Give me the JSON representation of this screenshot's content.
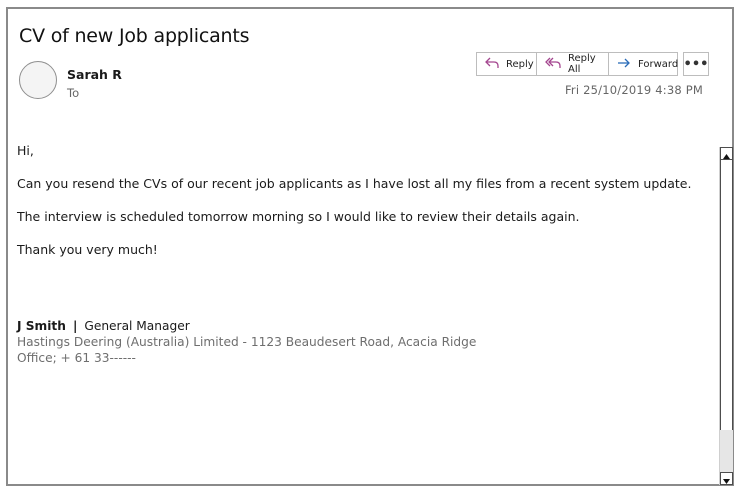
{
  "email": {
    "subject": "CV of new Job applicants",
    "sender": "Sarah R",
    "to_label": "To",
    "date": "Fri 25/10/2019 4:38 PM",
    "body": [
      "Hi,",
      "Can you resend the CVs of our recent job applicants as I have lost all my files from a recent system update.",
      "The interview is scheduled tomorrow morning so I would like to review their details again.",
      "Thank you very much!"
    ],
    "signature": {
      "name": "J Smith",
      "separator": "|",
      "title": "General Manager",
      "company_address": "Hastings Deering (Australia) Limited -  1123 Beaudesert Road, Acacia Ridge",
      "office": "Office; + 61 33------"
    }
  },
  "toolbar": {
    "reply_label": "Reply",
    "reply_all_label": "Reply All",
    "forward_label": "Forward",
    "more_label": "•••"
  },
  "icons": {
    "reply": "reply-arrow-icon",
    "reply_all": "reply-all-arrow-icon",
    "forward": "forward-arrow-icon",
    "scroll_up": "triangle-up-icon",
    "scroll_down": "triangle-down-icon"
  },
  "colors": {
    "reply_icon": "#a4468f",
    "forward_icon": "#2b6cb8",
    "window_border": "#8a8a8a"
  }
}
